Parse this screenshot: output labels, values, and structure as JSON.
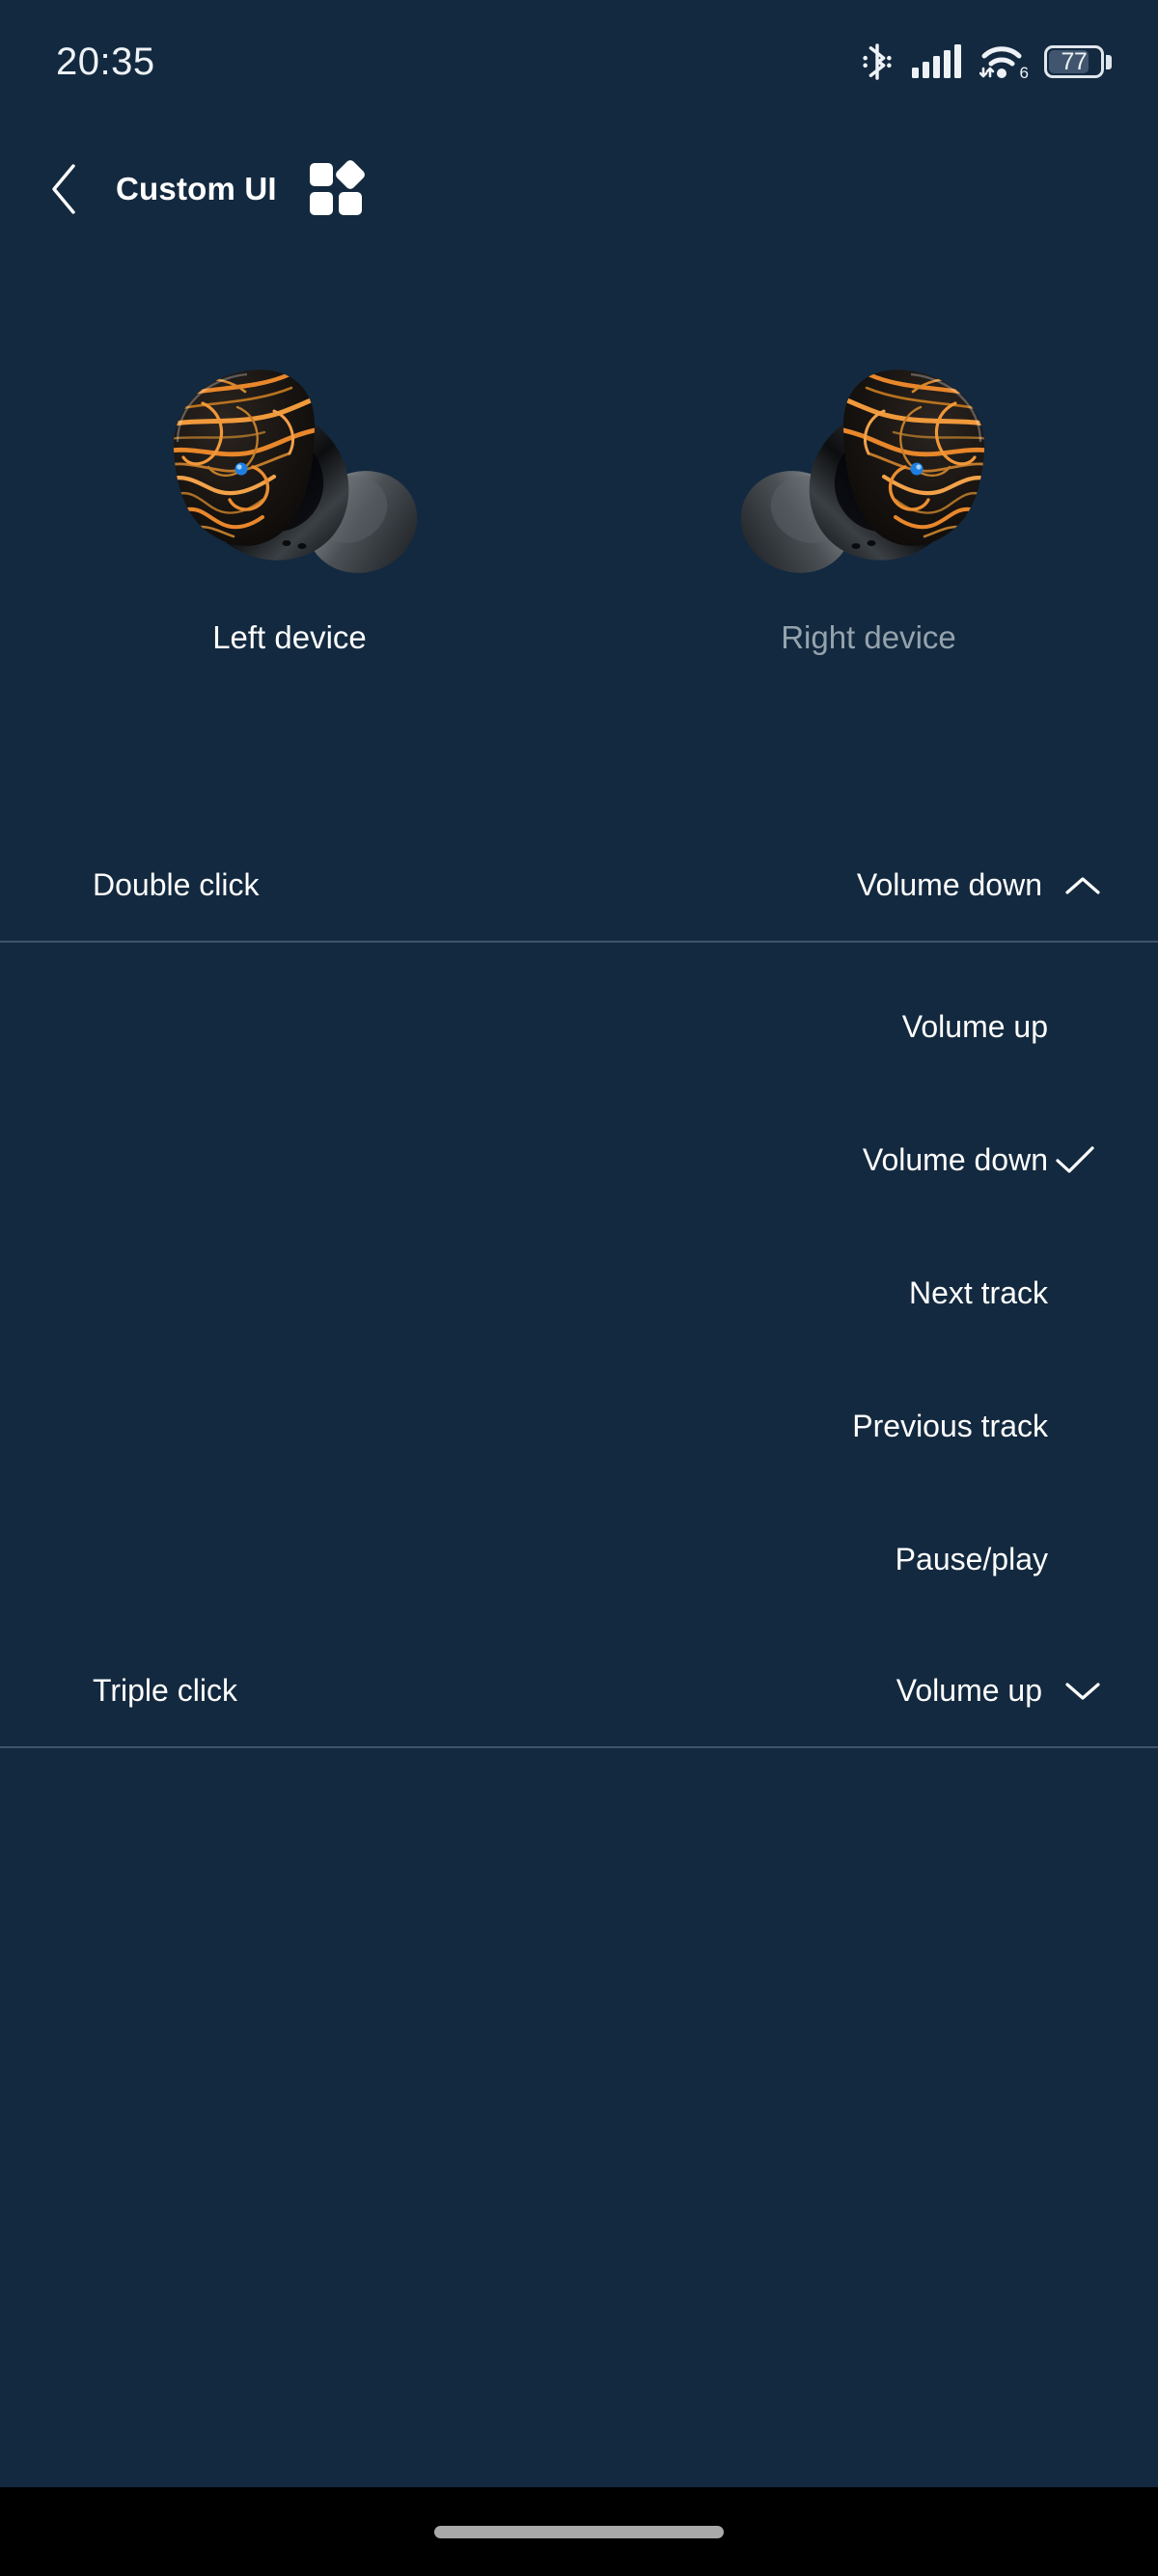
{
  "theme": {
    "background": "#13293f",
    "divider": "#3f5467",
    "text_primary": "#ffffff",
    "text_muted": "#94a3ad",
    "navbar": "#000000",
    "accent_orange": "#e8872b",
    "led_blue": "#1e7fe0"
  },
  "status_bar": {
    "time": "20:35",
    "bluetooth_icon": "bluetooth-icon",
    "signal_icon": "cellular-signal-icon",
    "signal_bars": 5,
    "wifi_icon": "wifi-icon",
    "wifi_generation": "6",
    "battery_icon": "battery-icon",
    "battery_percent": "77"
  },
  "header": {
    "back_icon": "chevron-left-icon",
    "title": "Custom UI",
    "grid_icon": "grid-apps-icon"
  },
  "devices": [
    {
      "label": "Left device",
      "state": "selected",
      "image": "left-earbud-image"
    },
    {
      "label": "Right device",
      "state": "unselected",
      "image": "right-earbud-image"
    }
  ],
  "rows": [
    {
      "name": "double-click",
      "label": "Double click",
      "value": "Volume down",
      "chevron": "chevron-up-icon",
      "expanded": true
    },
    {
      "name": "triple-click",
      "label": "Triple click",
      "value": "Volume up",
      "chevron": "chevron-down-icon",
      "expanded": false
    }
  ],
  "dropdown": {
    "for_row": "Double click",
    "check_icon": "check-icon",
    "options": [
      {
        "label": "Volume up",
        "selected": false
      },
      {
        "label": "Volume down",
        "selected": true
      },
      {
        "label": "Next track",
        "selected": false
      },
      {
        "label": "Previous track",
        "selected": false
      },
      {
        "label": "Pause/play",
        "selected": false
      }
    ]
  },
  "navbar": {
    "gesture_pill": "home-gesture-pill"
  }
}
